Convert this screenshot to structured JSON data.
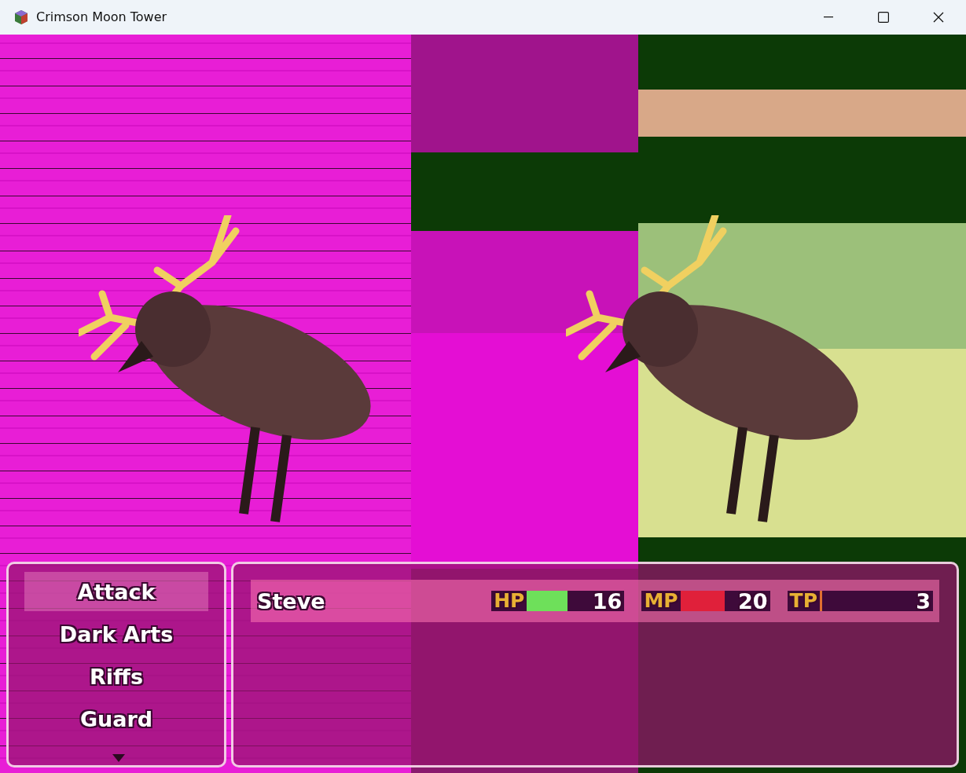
{
  "window": {
    "title": "Crimson Moon Tower"
  },
  "commands": [
    {
      "label": "Attack",
      "selected": true
    },
    {
      "label": "Dark Arts",
      "selected": false
    },
    {
      "label": "Riffs",
      "selected": false
    },
    {
      "label": "Guard",
      "selected": false
    }
  ],
  "party": [
    {
      "name": "Steve",
      "selected": true,
      "gauges": [
        {
          "label": "HP",
          "value": "16",
          "level": 0.64,
          "color": "#6ee05a"
        },
        {
          "label": "MP",
          "value": "20",
          "level": 0.8,
          "color": "#e0203a"
        },
        {
          "label": "TP",
          "value": "3",
          "level": 0.03,
          "color": "#e07030"
        }
      ]
    }
  ]
}
